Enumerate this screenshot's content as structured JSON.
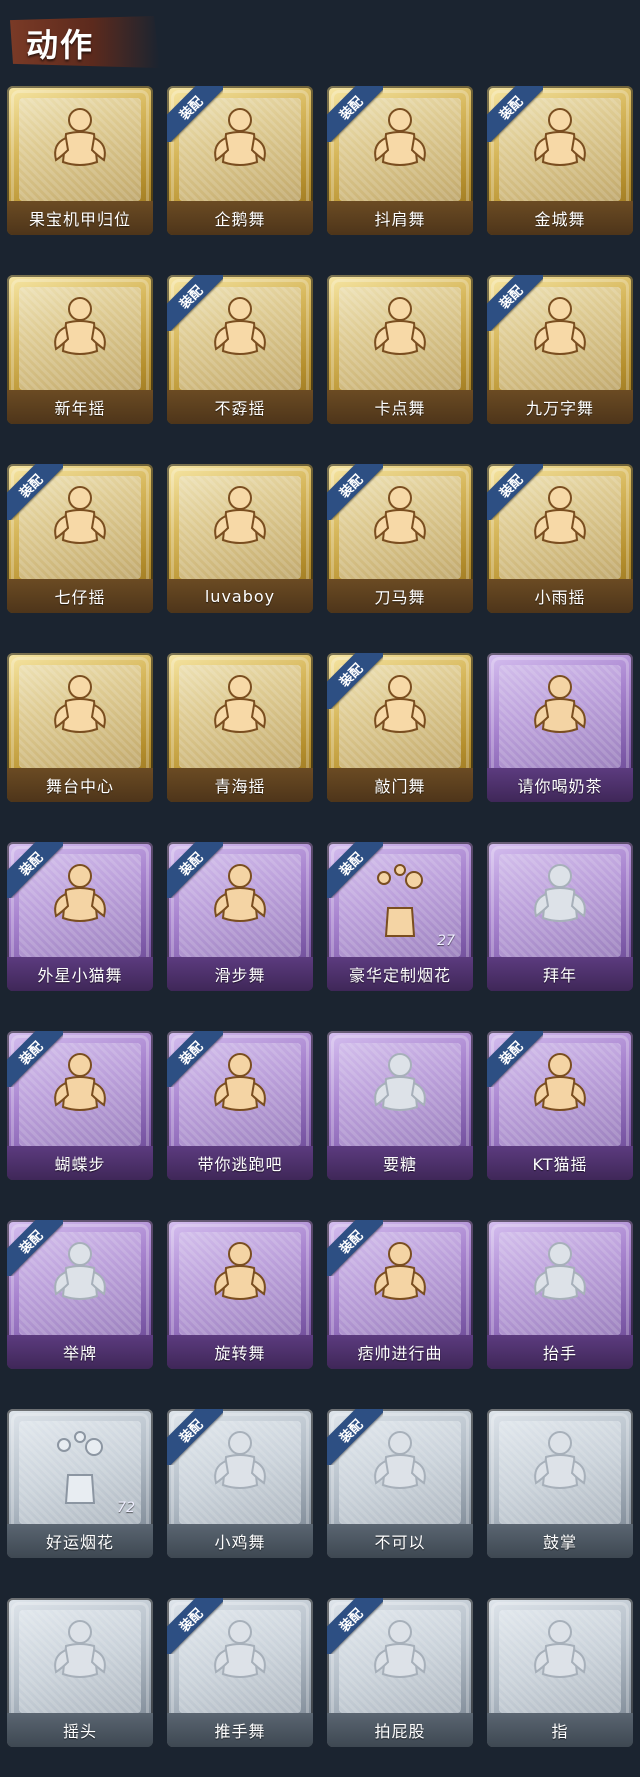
{
  "header": {
    "title": "动作"
  },
  "badge_text": "装配",
  "items": [
    {
      "label": "果宝机甲归位",
      "tier": "gold",
      "equipped": false,
      "count": "",
      "icon": "figure-icon"
    },
    {
      "label": "企鹅舞",
      "tier": "gold",
      "equipped": true,
      "count": "",
      "icon": "figure-icon"
    },
    {
      "label": "抖肩舞",
      "tier": "gold",
      "equipped": true,
      "count": "",
      "icon": "figure-icon"
    },
    {
      "label": "金城舞",
      "tier": "gold",
      "equipped": true,
      "count": "",
      "icon": "figure-icon"
    },
    {
      "label": "新年摇",
      "tier": "gold",
      "equipped": false,
      "count": "",
      "icon": "figure-icon"
    },
    {
      "label": "不孬摇",
      "tier": "gold",
      "equipped": true,
      "count": "",
      "icon": "figure-icon"
    },
    {
      "label": "卡点舞",
      "tier": "gold",
      "equipped": false,
      "count": "",
      "icon": "figure-icon"
    },
    {
      "label": "九万字舞",
      "tier": "gold",
      "equipped": true,
      "count": "",
      "icon": "figure-icon"
    },
    {
      "label": "七仔摇",
      "tier": "gold",
      "equipped": true,
      "count": "",
      "icon": "figure-icon"
    },
    {
      "label": "luvaboy",
      "tier": "gold",
      "equipped": false,
      "count": "",
      "icon": "figure-icon"
    },
    {
      "label": "刀马舞",
      "tier": "gold",
      "equipped": true,
      "count": "",
      "icon": "figure-icon"
    },
    {
      "label": "小雨摇",
      "tier": "gold",
      "equipped": true,
      "count": "",
      "icon": "figure-icon"
    },
    {
      "label": "舞台中心",
      "tier": "gold",
      "equipped": false,
      "count": "",
      "icon": "figure-icon"
    },
    {
      "label": "青海摇",
      "tier": "gold",
      "equipped": false,
      "count": "",
      "icon": "figure-icon"
    },
    {
      "label": "敲门舞",
      "tier": "gold",
      "equipped": true,
      "count": "",
      "icon": "figure-icon"
    },
    {
      "label": "请你喝奶茶",
      "tier": "purple",
      "equipped": false,
      "count": "",
      "icon": "figure-icon"
    },
    {
      "label": "外星小猫舞",
      "tier": "purple",
      "equipped": true,
      "count": "",
      "icon": "figure-icon"
    },
    {
      "label": "滑步舞",
      "tier": "purple",
      "equipped": true,
      "count": "",
      "icon": "figure-icon"
    },
    {
      "label": "豪华定制烟花",
      "tier": "purple",
      "equipped": true,
      "count": "27",
      "icon": "fireworks-icon"
    },
    {
      "label": "拜年",
      "tier": "purple",
      "equipped": false,
      "count": "",
      "icon": "figure-icon",
      "greyed": true
    },
    {
      "label": "蝴蝶步",
      "tier": "purple",
      "equipped": true,
      "count": "",
      "icon": "figure-icon"
    },
    {
      "label": "带你逃跑吧",
      "tier": "purple",
      "equipped": true,
      "count": "",
      "icon": "figure-icon"
    },
    {
      "label": "要糖",
      "tier": "purple",
      "equipped": false,
      "count": "",
      "icon": "figure-icon",
      "greyed": true
    },
    {
      "label": "KT猫摇",
      "tier": "purple",
      "equipped": true,
      "count": "",
      "icon": "figure-icon"
    },
    {
      "label": "举牌",
      "tier": "purple",
      "equipped": true,
      "count": "",
      "icon": "sign-icon",
      "greyed": true
    },
    {
      "label": "旋转舞",
      "tier": "purple",
      "equipped": false,
      "count": "",
      "icon": "figure-icon"
    },
    {
      "label": "痞帅进行曲",
      "tier": "purple",
      "equipped": true,
      "count": "",
      "icon": "figure-icon"
    },
    {
      "label": "抬手",
      "tier": "purple",
      "equipped": false,
      "count": "",
      "icon": "hand-icon",
      "greyed": true
    },
    {
      "label": "好运烟花",
      "tier": "silver",
      "equipped": false,
      "count": "72",
      "icon": "fireworks-icon"
    },
    {
      "label": "小鸡舞",
      "tier": "silver",
      "equipped": true,
      "count": "",
      "icon": "figure-icon",
      "greyed": true
    },
    {
      "label": "不可以",
      "tier": "silver",
      "equipped": true,
      "count": "",
      "icon": "finger-icon",
      "greyed": true
    },
    {
      "label": "鼓掌",
      "tier": "silver",
      "equipped": false,
      "count": "",
      "icon": "hands-icon",
      "greyed": true
    },
    {
      "label": "摇头",
      "tier": "silver",
      "equipped": false,
      "count": "",
      "icon": "figure-icon",
      "greyed": true
    },
    {
      "label": "推手舞",
      "tier": "silver",
      "equipped": true,
      "count": "",
      "icon": "figure-icon",
      "greyed": true
    },
    {
      "label": "拍屁股",
      "tier": "silver",
      "equipped": true,
      "count": "",
      "icon": "figure-icon",
      "greyed": true
    },
    {
      "label": "指",
      "tier": "silver",
      "equipped": false,
      "count": "",
      "icon": "hand-icon",
      "greyed": true
    }
  ]
}
